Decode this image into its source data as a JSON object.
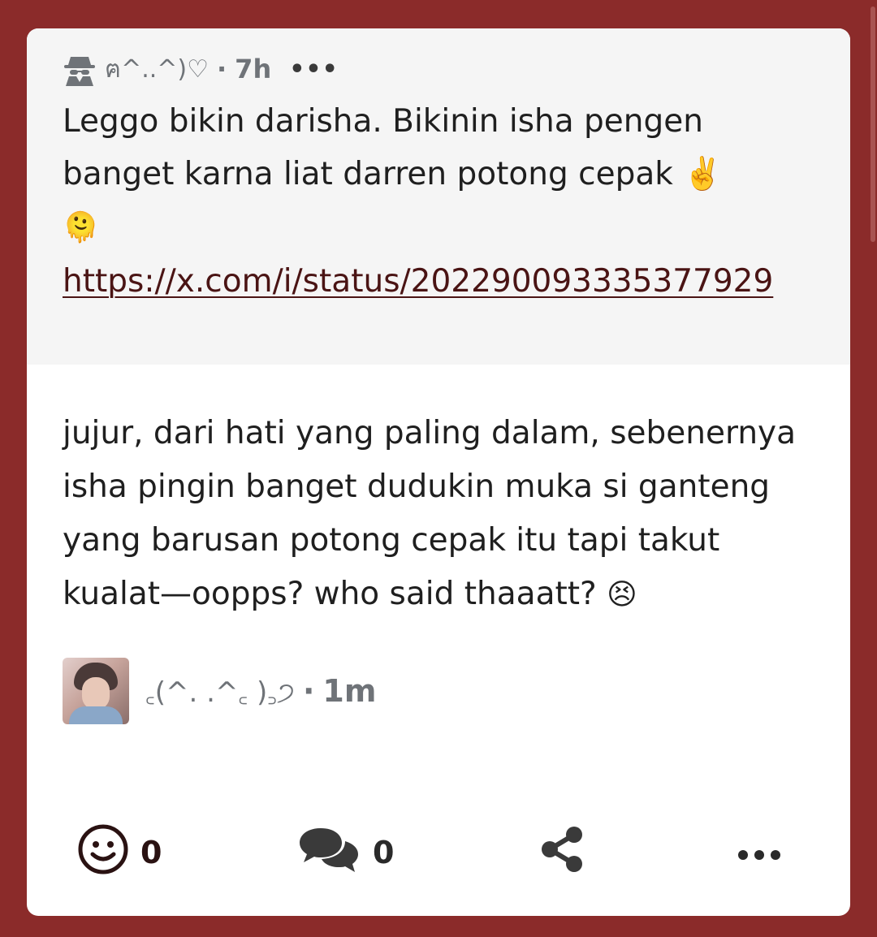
{
  "quoted_post": {
    "author": "ฅ^..^)♡",
    "time": "7h",
    "text": "Leggo bikin darisha. Bikinin isha pengen banget karna liat darren potong cepak ✌️",
    "emoji": "🫠",
    "link": "https://x.com/i/status/202290093335377929"
  },
  "post": {
    "body": "jujur, dari hati yang paling dalam, sebenernya isha pingin banget dudukin muka si ganteng yang barusan potong cepak itu tapi takut kualat—oopps? who said thaaatt?",
    "emoji": "😣"
  },
  "author": {
    "name": "꜀(^. .^꜀ )꜆੭",
    "time": "1m"
  },
  "actions": {
    "reactions_count": "0",
    "comments_count": "0"
  },
  "icons": {
    "quote_author_icon": "spy-icon",
    "reaction": "smiley-icon",
    "comment": "comments-icon",
    "share": "share-icon",
    "more": "ellipsis-icon"
  },
  "colors": {
    "background": "#8b2b2a",
    "card": "#ffffff",
    "quote_background": "#f5f5f5",
    "link": "#4a1414"
  }
}
